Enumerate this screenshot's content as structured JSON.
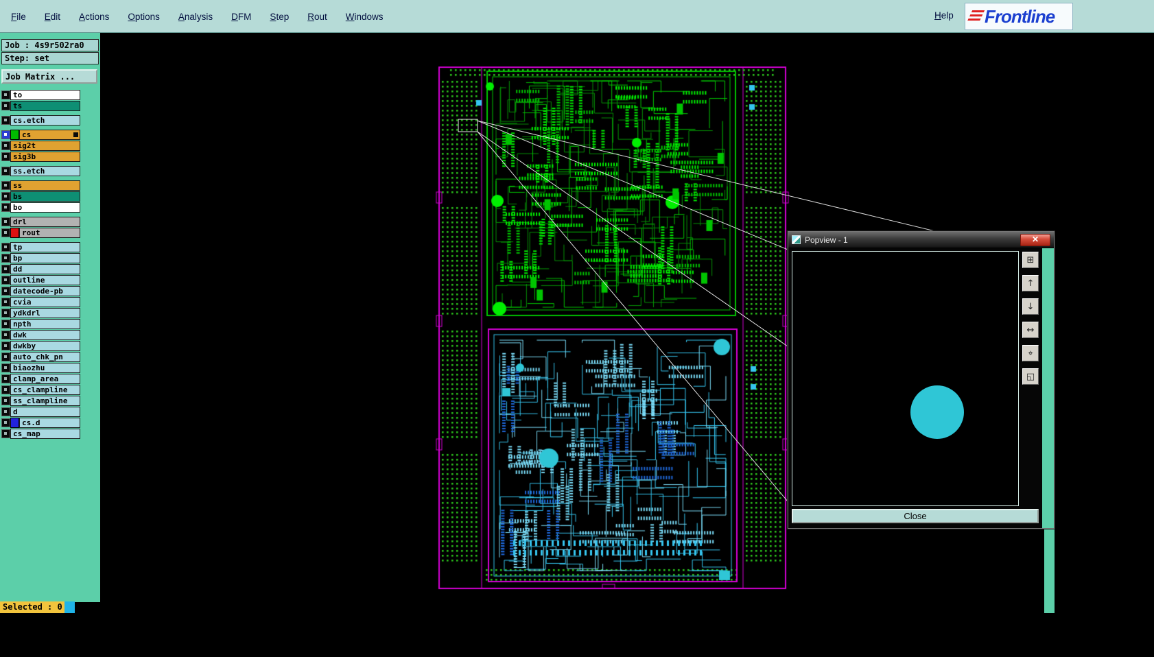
{
  "menubar": {
    "items": [
      "File",
      "Edit",
      "Actions",
      "Options",
      "Analysis",
      "DFM",
      "Step",
      "Rout",
      "Windows"
    ],
    "help": "Help",
    "logo": "Frontline"
  },
  "sidebar": {
    "job": "Job : 4s9r502ra0",
    "step": "Step: set",
    "job_matrix": "Job Matrix ...",
    "selected": "Selected : 0",
    "layers": [
      {
        "name": "to",
        "bg": "#ffffff"
      },
      {
        "name": "ts",
        "bg": "#0e8f74",
        "gap_after": true
      },
      {
        "name": "cs.etch",
        "bg": "#a9d9e2",
        "gap_after": true
      },
      {
        "name": "cs",
        "bg": "#e0a231",
        "swatch": "#00bb00",
        "active": true,
        "marker": true
      },
      {
        "name": "sig2t",
        "bg": "#e0a231"
      },
      {
        "name": "sig3b",
        "bg": "#e0a231",
        "gap_after": true
      },
      {
        "name": "ss.etch",
        "bg": "#a9d9e2",
        "gap_after": true
      },
      {
        "name": "ss",
        "bg": "#e0a231"
      },
      {
        "name": "bs",
        "bg": "#0e8f74"
      },
      {
        "name": "bo",
        "bg": "#ffffff",
        "gap_after": true
      },
      {
        "name": "drl",
        "bg": "#b2b2b2"
      },
      {
        "name": "rout",
        "bg": "#b2b2b2",
        "swatch": "#dd1111",
        "gap_after": true
      },
      {
        "name": "tp",
        "bg": "#a9d9e2"
      },
      {
        "name": "bp",
        "bg": "#a9d9e2"
      },
      {
        "name": "dd",
        "bg": "#a9d9e2"
      },
      {
        "name": "outline",
        "bg": "#a9d9e2"
      },
      {
        "name": "datecode-pb",
        "bg": "#a9d9e2"
      },
      {
        "name": "cvia",
        "bg": "#a9d9e2"
      },
      {
        "name": "ydkdrl",
        "bg": "#a9d9e2"
      },
      {
        "name": "npth",
        "bg": "#a9d9e2"
      },
      {
        "name": "dwk",
        "bg": "#a9d9e2"
      },
      {
        "name": "dwkby",
        "bg": "#a9d9e2"
      },
      {
        "name": "auto_chk_pn",
        "bg": "#a9d9e2"
      },
      {
        "name": "biaozhu",
        "bg": "#a9d9e2"
      },
      {
        "name": "clamp_area",
        "bg": "#a9d9e2"
      },
      {
        "name": "cs_clampline",
        "bg": "#a9d9e2"
      },
      {
        "name": "ss_clampline",
        "bg": "#a9d9e2"
      },
      {
        "name": "d",
        "bg": "#a9d9e2"
      },
      {
        "name": "cs.d",
        "bg": "#a9d9e2",
        "swatch": "#2222dd"
      },
      {
        "name": "cs_map",
        "bg": "#a9d9e2"
      }
    ]
  },
  "popview": {
    "title": "Popview - 1",
    "close": "Close",
    "toolbar": [
      {
        "name": "capture-view-button",
        "glyph": "⊞"
      },
      {
        "name": "previous-view-button",
        "glyph": "↑"
      },
      {
        "name": "next-view-button",
        "glyph": "↓"
      },
      {
        "name": "swap-view-button",
        "glyph": "↔"
      },
      {
        "name": "center-view-button",
        "glyph": "⌖"
      },
      {
        "name": "fit-view-button",
        "glyph": "◱"
      }
    ]
  },
  "colors": {
    "sidebar_teal": "#5ccfa9",
    "menubar_teal": "#b6dbd7",
    "pcb_green": "#00c400",
    "pcb_green_bright": "#00ef00",
    "pcb_green_dim": "#069106",
    "via_dot_green": "#2cc21c",
    "pcb_cyan": "#35c4ee",
    "pcb_cyan_bright": "#7adcf8",
    "pcb_blue": "#1e66d6",
    "pad_cyan": "#2fc6d6",
    "outline_magenta": "#d400d4",
    "selected_yellow": "#f2c43d",
    "chip_blue": "#1fb4e8"
  }
}
